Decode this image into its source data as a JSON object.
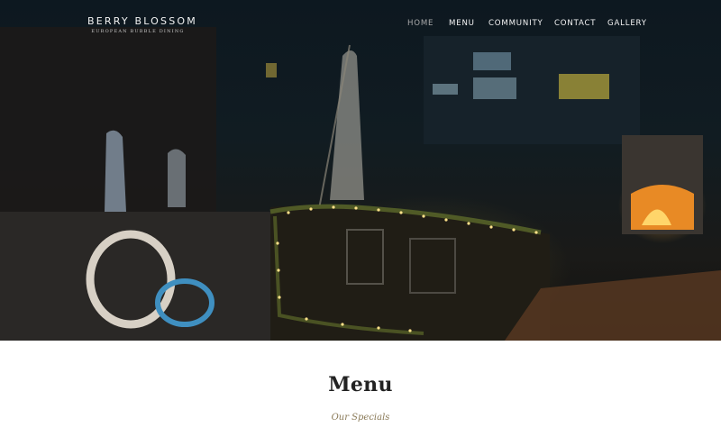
{
  "brand": {
    "name": "BERRY BLOSSOM",
    "tagline": "EUROPEAN BUBBLE DINING"
  },
  "nav": {
    "home": "HOME",
    "menu": "MENU",
    "community": "COMMUNITY",
    "contact": "CONTACT",
    "gallery": "GALLERY",
    "active": "HOME"
  },
  "section": {
    "title": "Menu",
    "subtitle": "Our Specials"
  },
  "colors": {
    "nav_text": "#f4f4f4",
    "nav_active": "#a9a9a9",
    "subtitle": "#8a7a58",
    "title": "#222222"
  }
}
